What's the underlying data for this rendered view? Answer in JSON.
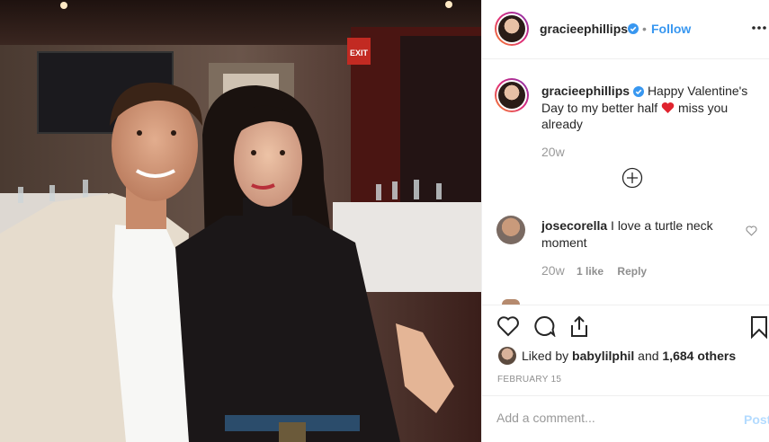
{
  "header": {
    "username": "gracieephillips",
    "separator": "•",
    "follow_label": "Follow"
  },
  "caption": {
    "username": "gracieephillips",
    "text_before": "Happy Valentine's Day to my better half",
    "emoji": "heart-emoji",
    "text_after": "miss you already",
    "age": "20w"
  },
  "comments": [
    {
      "username": "josecorella",
      "text": "I love a turtle neck moment",
      "age": "20w",
      "likes": "1 like",
      "reply_label": "Reply"
    }
  ],
  "stats": {
    "liked_by_prefix": "Liked by",
    "liked_by_user": "babylilphil",
    "and": "and",
    "others": "1,684 others",
    "date": "FEBRUARY 15"
  },
  "add_comment": {
    "placeholder": "Add a comment...",
    "post_label": "Post"
  },
  "photo": {
    "exit_sign": "EXIT"
  },
  "colors": {
    "accent_blue": "#3897f0",
    "heart_red": "#ed4956",
    "muted": "#8e8e8e"
  }
}
